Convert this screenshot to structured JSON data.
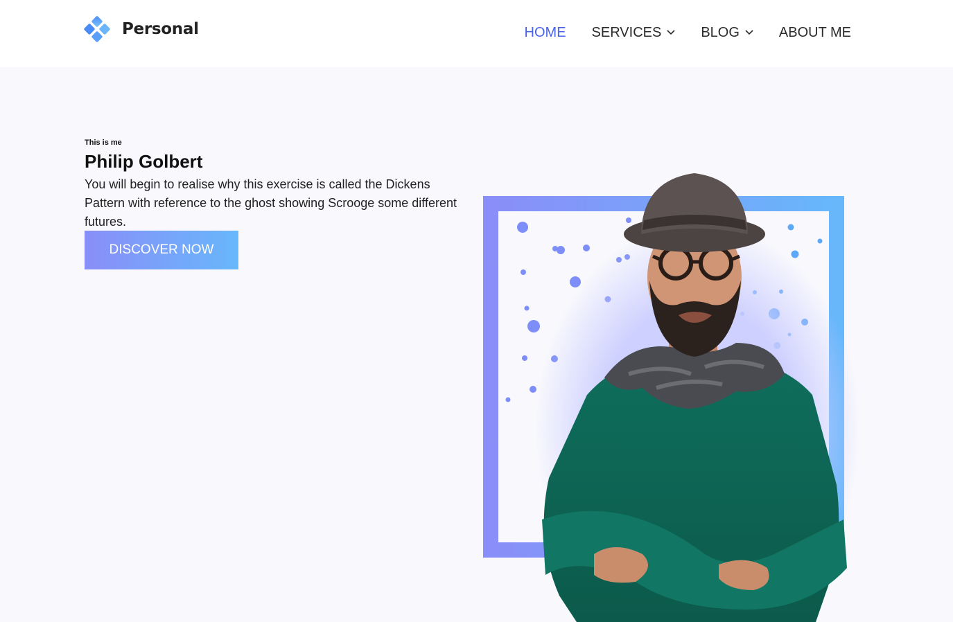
{
  "brand": {
    "name": "Personal",
    "icon": "four-diamond-logo-icon",
    "color_primary": "#4a8cf7",
    "color_secondary": "#6bb6fb"
  },
  "nav": {
    "items": [
      {
        "label": "HOME",
        "active": true,
        "has_dropdown": false
      },
      {
        "label": "SERVICES",
        "active": false,
        "has_dropdown": true
      },
      {
        "label": "BLOG",
        "active": false,
        "has_dropdown": true
      },
      {
        "label": "ABOUT ME",
        "active": false,
        "has_dropdown": false
      }
    ],
    "active_color": "#4a63e8"
  },
  "hero": {
    "eyebrow": "This is me",
    "name": "Philip Golbert",
    "description": "You will begin to realise why this exercise is called the Dickens Pattern with reference to the ghost showing Scrooge some different futures.",
    "cta_label": "DISCOVER NOW",
    "gradient_start": "#8a8ef8",
    "gradient_end": "#67b7fb"
  }
}
